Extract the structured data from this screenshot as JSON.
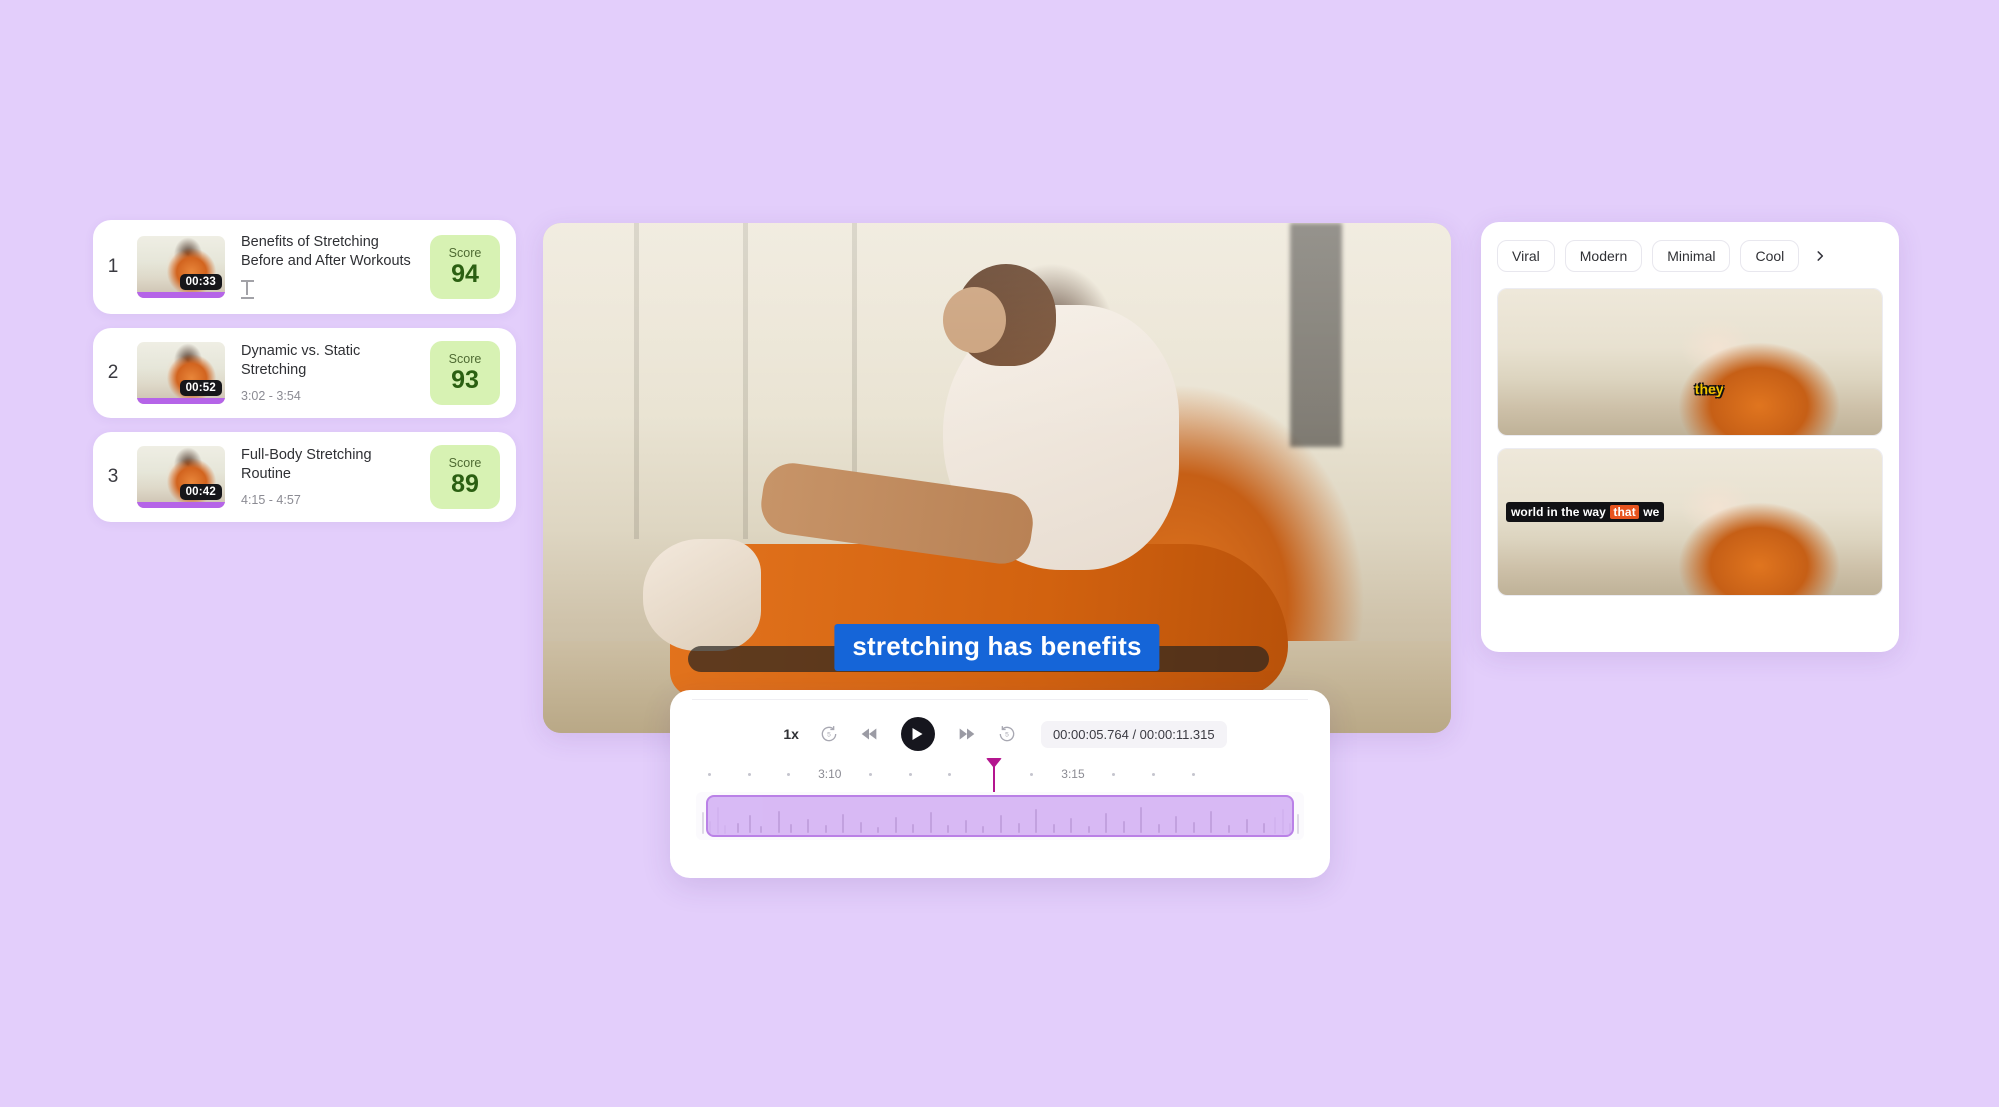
{
  "theme": {
    "background": "#e3cefb",
    "accent": "#b4158f",
    "caption_blue": "#1565d8",
    "score_bg": "#d7f2b3",
    "score_fg": "#2b6012"
  },
  "clip_list": {
    "items": [
      {
        "index": "1",
        "title": "Benefits of Stretching Before and After Workouts",
        "subtitle": "",
        "has_cursor": true,
        "duration": "00:33",
        "score_label": "Score",
        "score_value": "94"
      },
      {
        "index": "2",
        "title": "Dynamic vs. Static Stretching",
        "subtitle": "3:02 - 3:54",
        "has_cursor": false,
        "duration": "00:52",
        "score_label": "Score",
        "score_value": "93"
      },
      {
        "index": "3",
        "title": "Full-Body Stretching Routine",
        "subtitle": "4:15 - 4:57",
        "has_cursor": false,
        "duration": "00:42",
        "score_label": "Score",
        "score_value": "89"
      }
    ]
  },
  "video": {
    "caption": "stretching has benefits"
  },
  "player": {
    "speed": "1x",
    "rewind_5_label": "5",
    "forward_5_label": "5",
    "current_time": "00:00:05.764",
    "separator": "/",
    "total_time": "00:00:11.315",
    "time_readout": "00:00:05.764 / 00:00:11.315",
    "ruler_labels": [
      "3:10",
      "3:15"
    ],
    "playhead_position_pct": 49
  },
  "style_panel": {
    "tabs": [
      "Viral",
      "Modern",
      "Minimal",
      "Cool"
    ],
    "next_icon": "chevron-right-icon",
    "previews": [
      {
        "style": "yellow-outline",
        "caption": "they"
      },
      {
        "style": "black-box",
        "caption_before": "world in the way",
        "caption_highlight": "that",
        "caption_after": "we"
      }
    ]
  }
}
